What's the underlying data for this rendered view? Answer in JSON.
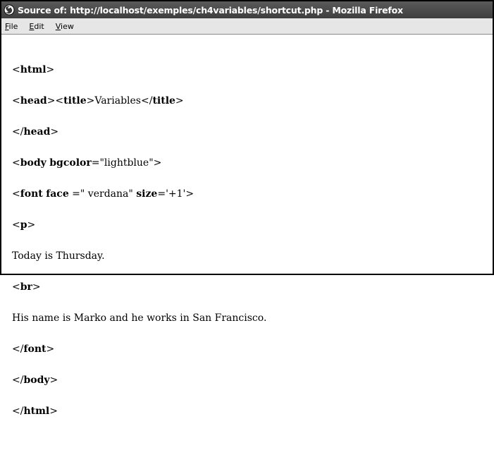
{
  "window": {
    "title": "Source of: http://localhost/exemples/ch4variables/shortcut.php - Mozilla Firefox"
  },
  "menu": {
    "file": {
      "accel": "F",
      "rest": "ile"
    },
    "edit": {
      "accel": "E",
      "rest": "dit"
    },
    "view": {
      "accel": "V",
      "rest": "iew"
    }
  },
  "source": {
    "l1": {
      "open": "<",
      "tag": "html",
      "close": ">"
    },
    "l2": {
      "o1": "<",
      "t1": "head",
      "c1": "><",
      "t2": "title",
      "c2": ">",
      "text": "Variables",
      "o3": "</",
      "t3": "title",
      "c3": ">"
    },
    "l3": {
      "open": "</",
      "tag": "head",
      "close": ">"
    },
    "l4": {
      "open": "<",
      "tag": "body",
      "sp": " ",
      "attr": "bgcolor",
      "eq": "=",
      "val": "\"lightblue\"",
      "close": ">"
    },
    "l5": {
      "open": "<",
      "tag": "font",
      "sp1": " ",
      "attr1": "face",
      "eq1": " =",
      "val1": "\" verdana\"",
      "sp2": " ",
      "attr2": "size",
      "eq2": "=",
      "val2": "'+1'",
      "close": ">"
    },
    "l6": {
      "open": "<",
      "tag": "p",
      "close": ">"
    },
    "l7": {
      "text": "Today is Thursday."
    },
    "l8": {
      "open": "<",
      "tag": "br",
      "close": ">"
    },
    "l9": {
      "text": "His name is Marko and he works in San Francisco."
    },
    "l10": {
      "open": "</",
      "tag": "font",
      "close": ">"
    },
    "l11": {
      "open": "</",
      "tag": "body",
      "close": ">"
    },
    "l12": {
      "open": "</",
      "tag": "html",
      "close": ">"
    }
  },
  "colors": {
    "titlebar": "#4a4a4a",
    "menubar": "#e6e6e6",
    "text": "#000000"
  },
  "icons": {
    "app": "firefox-icon"
  }
}
